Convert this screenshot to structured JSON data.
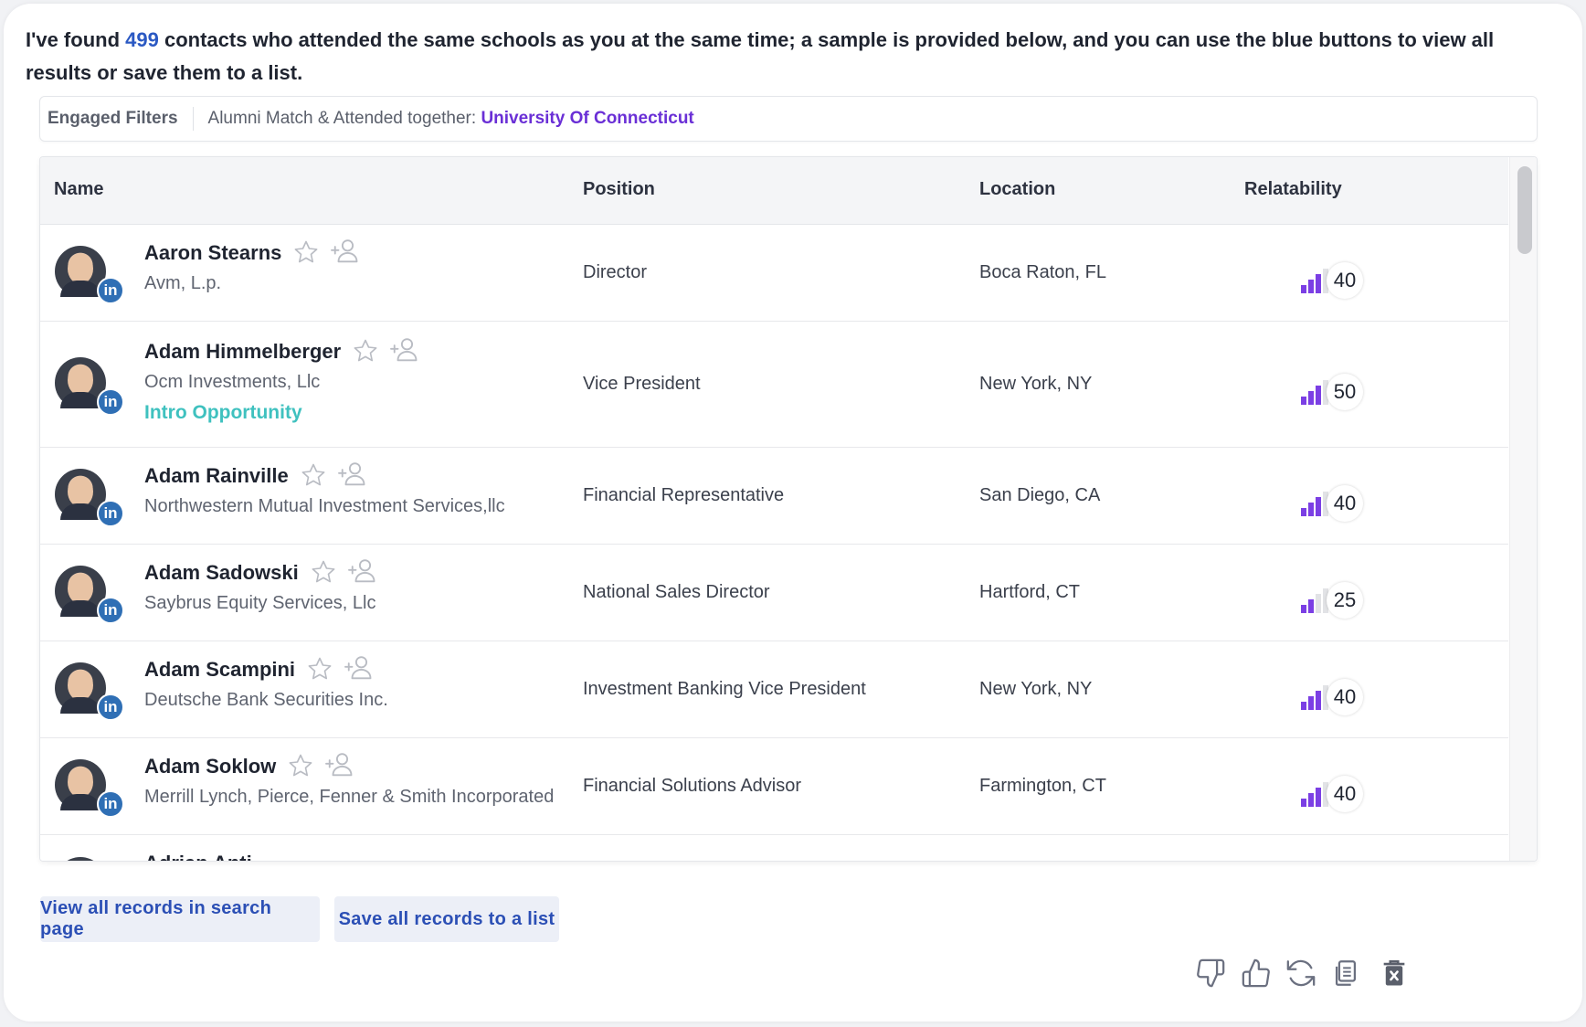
{
  "intro": {
    "prefix": "I've found ",
    "count": "499",
    "suffix": " contacts who attended the same schools as you at the same time; a sample is provided below, and you can use the blue buttons to view all results or save them to a list."
  },
  "filters": {
    "label": "Engaged Filters",
    "text": "Alumni Match & Attended together: ",
    "school": "University Of Connecticut"
  },
  "table": {
    "headers": {
      "name": "Name",
      "position": "Position",
      "location": "Location",
      "relatability": "Relatability"
    },
    "rows": [
      {
        "name": "Aaron Stearns",
        "company": "Avm, L.p.",
        "intro": "",
        "position": "Director",
        "location": "Boca Raton, FL",
        "score": "40",
        "level": 3
      },
      {
        "name": "Adam Himmelberger",
        "company": "Ocm Investments, Llc",
        "intro": "Intro Opportunity",
        "position": "Vice President",
        "location": "New York, NY",
        "score": "50",
        "level": 3
      },
      {
        "name": "Adam Rainville",
        "company": "Northwestern Mutual Investment Services,llc",
        "intro": "",
        "position": "Financial Representative",
        "location": "San Diego, CA",
        "score": "40",
        "level": 3
      },
      {
        "name": "Adam Sadowski",
        "company": "Saybrus Equity Services, Llc",
        "intro": "",
        "position": "National Sales Director",
        "location": "Hartford, CT",
        "score": "25",
        "level": 2
      },
      {
        "name": "Adam Scampini",
        "company": "Deutsche Bank Securities Inc.",
        "intro": "",
        "position": "Investment Banking Vice President",
        "location": "New York, NY",
        "score": "40",
        "level": 3
      },
      {
        "name": "Adam Soklow",
        "company": "Merrill Lynch, Pierce, Fenner & Smith Incorporated",
        "intro": "",
        "position": "Financial Solutions Advisor",
        "location": "Farmington, CT",
        "score": "40",
        "level": 3
      }
    ],
    "partial_row_name": "Adrian Anti..."
  },
  "buttons": {
    "view_all": "View all records in search page",
    "save_all": "Save all records to a list"
  },
  "colors": {
    "accent": "#2b59c3",
    "school": "#6a2fd6",
    "intro_op": "#3fc1bf",
    "bar_active": "#7b3fe4",
    "bar_inactive": "#e2e3e6"
  },
  "icons": [
    "star-icon",
    "add-user-icon",
    "linkedin-icon",
    "thumbs-down-icon",
    "thumbs-up-icon",
    "refresh-icon",
    "copy-icon",
    "delete-icon"
  ]
}
